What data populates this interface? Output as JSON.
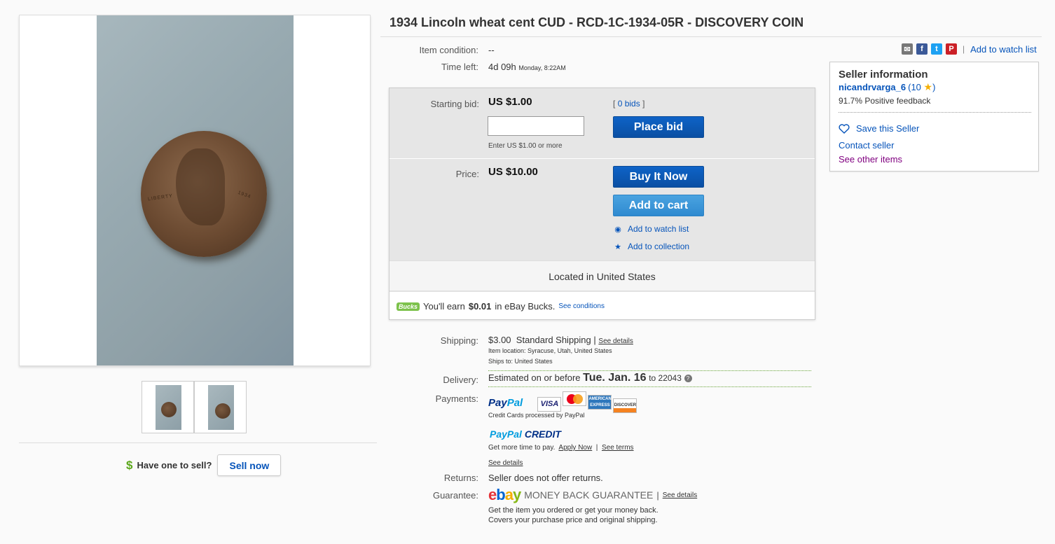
{
  "title": "1934 Lincoln wheat cent CUD - RCD-1C-1934-05R - DISCOVERY COIN",
  "coin_text": {
    "liberty": "LIBERTY",
    "year": "1934"
  },
  "item": {
    "condition_label": "Item condition:",
    "condition_value": "--",
    "time_left_label": "Time left:",
    "time_left_value": "4d 09h",
    "time_left_when": "Monday, 8:22AM"
  },
  "share": {
    "icons": [
      "email-icon",
      "facebook-icon",
      "twitter-icon",
      "pinterest-icon"
    ],
    "watch_label": "Add to watch list"
  },
  "bid": {
    "starting_label": "Starting bid:",
    "starting_value": "US $1.00",
    "bids_link": "0 bids",
    "bracket_open": "[",
    "bracket_close": "]",
    "input_value": "",
    "hint": "Enter US $1.00 or more",
    "place_bid": "Place bid"
  },
  "buy": {
    "price_label": "Price:",
    "price_value": "US $10.00",
    "buy_now": "Buy It Now",
    "add_to_cart": "Add to cart",
    "watch": "Add to watch list",
    "collection": "Add to collection"
  },
  "located": "Located in United States",
  "bucks": {
    "badge": "Bucks",
    "text_pre": "You'll earn",
    "amount": "$0.01",
    "text_post": "in eBay Bucks.",
    "see": "See conditions"
  },
  "shipping": {
    "label": "Shipping:",
    "price": "$3.00",
    "method": "Standard Shipping",
    "pipe": "|",
    "see_details": "See details",
    "location_label": "Item location:",
    "location_value": "Syracuse, Utah, United States",
    "ships_label": "Ships to:",
    "ships_value": "United States"
  },
  "delivery": {
    "label": "Delivery:",
    "prefix": "Estimated on or before",
    "date": "Tue. Jan. 16",
    "to": "to 22043",
    "help": "?"
  },
  "payments": {
    "label": "Payments:",
    "paypal_a": "Pay",
    "paypal_b": "Pal",
    "cards": [
      "VISA",
      "MasterCard",
      "AMERICAN EXPRESS",
      "DISCOVER"
    ],
    "processed": "Credit Cards processed by PayPal",
    "credit_a": "PayPal",
    "credit_b": "CREDIT",
    "credit_text": "Get more time to pay.",
    "apply": "Apply Now",
    "sep": "|",
    "terms": "See terms",
    "see_details": "See details"
  },
  "returns": {
    "label": "Returns:",
    "value": "Seller does not offer returns."
  },
  "guarantee": {
    "label": "Guarantee:",
    "ebay": [
      "e",
      "b",
      "a",
      "y"
    ],
    "mbg": "MONEY BACK GUARANTEE",
    "pipe": "|",
    "see_details": "See details",
    "line1": "Get the item you ordered or get your money back.",
    "line2": "Covers your purchase price and original shipping."
  },
  "seller": {
    "heading": "Seller information",
    "username": "nicandrvarga_6",
    "score_open": "(10",
    "score_close": ")",
    "feedback": "91.7% Positive feedback",
    "save": "Save this Seller",
    "contact": "Contact seller",
    "other": "See other items"
  },
  "sell": {
    "question": "Have one to sell?",
    "button": "Sell now"
  },
  "colors": {
    "link": "#0654ba",
    "primary_button": "#0a57b5",
    "secondary_button": "#3b97d9",
    "bucks_green": "#7dc24c"
  }
}
